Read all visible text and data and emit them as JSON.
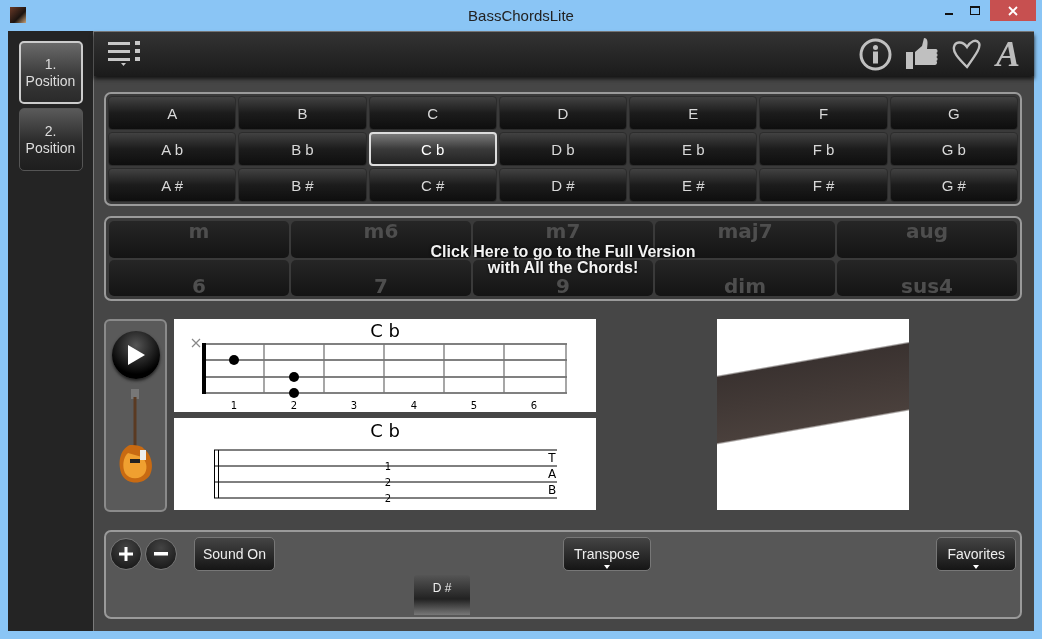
{
  "window": {
    "title": "BassChordsLite"
  },
  "positions": [
    {
      "label": "1. Position",
      "selected": true
    },
    {
      "label": "2. Position",
      "selected": false
    }
  ],
  "toolbar": {
    "font_glyph": "A"
  },
  "key_rows": [
    {
      "keys": [
        {
          "label": "A",
          "selected": false
        },
        {
          "label": "B",
          "selected": false
        },
        {
          "label": "C",
          "selected": false
        },
        {
          "label": "D",
          "selected": false
        },
        {
          "label": "E",
          "selected": false
        },
        {
          "label": "F",
          "selected": false
        },
        {
          "label": "G",
          "selected": false
        }
      ]
    },
    {
      "keys": [
        {
          "label": "A b",
          "selected": false
        },
        {
          "label": "B b",
          "selected": false
        },
        {
          "label": "C b",
          "selected": true
        },
        {
          "label": "D b",
          "selected": false
        },
        {
          "label": "E b",
          "selected": false
        },
        {
          "label": "F b",
          "selected": false
        },
        {
          "label": "G b",
          "selected": false
        }
      ]
    },
    {
      "keys": [
        {
          "label": "A #",
          "selected": false
        },
        {
          "label": "B #",
          "selected": false
        },
        {
          "label": "C #",
          "selected": false
        },
        {
          "label": "D #",
          "selected": false
        },
        {
          "label": "E #",
          "selected": false
        },
        {
          "label": "F #",
          "selected": false
        },
        {
          "label": "G #",
          "selected": false
        }
      ]
    }
  ],
  "chord_types": {
    "items": [
      "m",
      "m6",
      "m7",
      "maj7",
      "aug",
      "6",
      "7",
      "9",
      "dim",
      "sus4"
    ],
    "message": "Click Here to go to the Full Version with All the Chords!"
  },
  "diagram": {
    "title": "C b",
    "fret_numbers": [
      "1",
      "2",
      "3",
      "4",
      "5",
      "6"
    ],
    "strings": [
      {
        "muted": true,
        "pressed": [
          false,
          false,
          false,
          false,
          false,
          false
        ]
      },
      {
        "muted": false,
        "pressed": [
          true,
          false,
          false,
          false,
          false,
          false
        ]
      },
      {
        "muted": false,
        "pressed": [
          false,
          true,
          false,
          false,
          false,
          false
        ]
      },
      {
        "muted": false,
        "pressed": [
          false,
          true,
          false,
          false,
          false,
          false
        ]
      }
    ]
  },
  "tab": {
    "title": "C b",
    "letters": [
      "T",
      "A",
      "B"
    ],
    "notes": [
      "1",
      "2",
      "2"
    ]
  },
  "bottom": {
    "buttons": [
      {
        "kind": "plus"
      },
      {
        "kind": "minus"
      },
      {
        "kind": "text",
        "label": "Sound On"
      },
      {
        "kind": "menu",
        "label": "Transpose"
      },
      {
        "kind": "menu",
        "label": "Favorites"
      }
    ],
    "key_tab": "D #"
  }
}
